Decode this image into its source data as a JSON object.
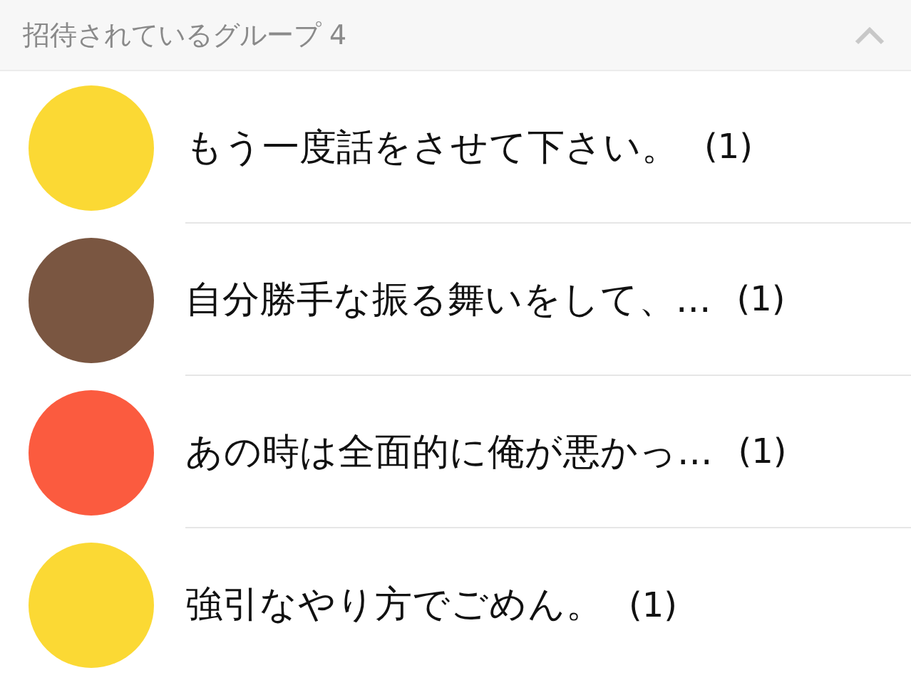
{
  "header": {
    "title": "招待されているグループ",
    "count": "4",
    "expanded": true
  },
  "groups": [
    {
      "name": "もう一度話をさせて下さい。",
      "count": "(1)",
      "color": "#fbd934"
    },
    {
      "name": "自分勝手な振る舞いをして、...",
      "count": "(1)",
      "color": "#7a5641"
    },
    {
      "name": "あの時は全面的に俺が悪かっ...",
      "count": "(1)",
      "color": "#fb5b3f"
    },
    {
      "name": "強引なやり方でごめん。",
      "count": "(1)",
      "color": "#fbd934"
    }
  ]
}
